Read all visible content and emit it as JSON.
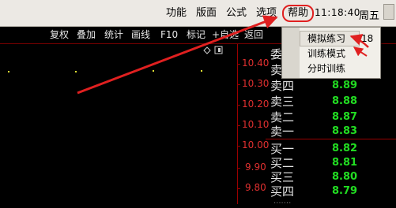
{
  "menubar": {
    "items": [
      "功能",
      "版面",
      "公式",
      "选项",
      "帮助"
    ],
    "clock": "11:18:40",
    "weekday": "周五"
  },
  "toolbar": {
    "items": [
      "复权",
      "叠加",
      "统计",
      "画线",
      "F10",
      "标记",
      "+自选",
      "返回"
    ]
  },
  "price_axis": {
    "ticks": [
      "10.40",
      "10.30",
      "10.20",
      "10.10",
      "10.00",
      "9.90",
      "9.80"
    ]
  },
  "order_book": {
    "sell_header": "委",
    "sells": [
      {
        "label": "卖五",
        "price": ""
      },
      {
        "label": "卖四",
        "price": "8.89"
      },
      {
        "label": "卖三",
        "price": "8.88"
      },
      {
        "label": "卖二",
        "price": "8.87"
      },
      {
        "label": "卖一",
        "price": "8.83"
      }
    ],
    "buys": [
      {
        "label": "买一",
        "price": "8.82"
      },
      {
        "label": "买二",
        "price": "8.81"
      },
      {
        "label": "买三",
        "price": "8.80"
      },
      {
        "label": "买四",
        "price": "8.79"
      }
    ],
    "footer": "·······"
  },
  "help_menu": {
    "items": [
      {
        "label": "模拟练习",
        "number": "18"
      },
      {
        "label": "训练模式",
        "number": ""
      },
      {
        "label": "分时训练",
        "number": ""
      }
    ]
  },
  "colors": {
    "menubar_bg": "#ece9e4",
    "annotation_red": "#e02020",
    "price_green": "#22dd22",
    "axis_red": "#e03030"
  }
}
